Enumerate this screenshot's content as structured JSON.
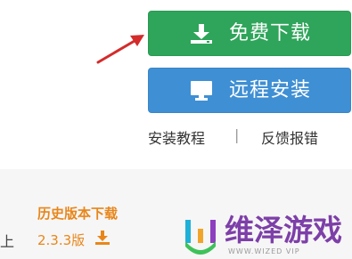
{
  "buttons": {
    "free_download": "免费下载",
    "remote_install": "远程安装"
  },
  "links": {
    "tutorial": "安装教程",
    "separator": "|",
    "feedback": "反馈报错"
  },
  "history": {
    "title": "历史版本下载",
    "version": "2.3.3版"
  },
  "partial_text": "上",
  "watermark": {
    "brand": "维泽游戏",
    "sub": "WWW.WIZED VIP"
  },
  "colors": {
    "green_button": "#2ea55a",
    "blue_button": "#3f8fd4",
    "orange_accent": "#e8861a",
    "arrow": "#d42b2b",
    "watermark_purple": "#7d3fa8"
  },
  "icons": {
    "free_download": "download-icon",
    "remote_install": "monitor-icon",
    "version": "download-icon",
    "pointer": "red-arrow"
  }
}
